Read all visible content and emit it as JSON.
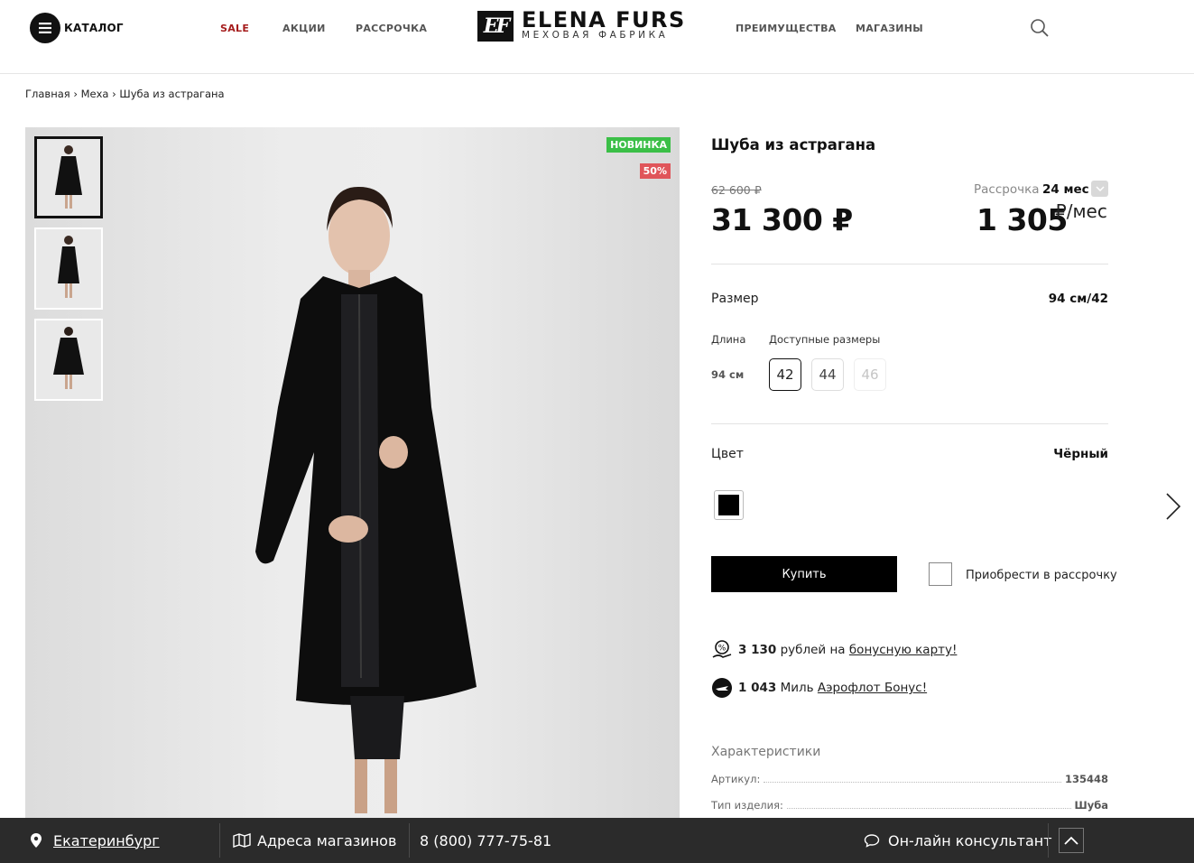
{
  "header": {
    "catalog_label": "КАТАЛОГ",
    "nav_left": [
      "SALE",
      "АКЦИИ",
      "РАССРОЧКА"
    ],
    "nav_right": [
      "ПРЕИМУЩЕСТВА",
      "МАГАЗИНЫ"
    ],
    "logo_mark": "EF",
    "logo_title": "ELENA FURS",
    "logo_subtitle": "МЕХОВАЯ ФАБРИКА",
    "sale_color": "#a51c1c"
  },
  "breadcrumb": [
    "Главная",
    "Меха",
    "Шуба из астрагана"
  ],
  "gallery": {
    "badge_new": "НОВИНКА",
    "badge_discount": "50%",
    "thumbnails_count": 3
  },
  "product": {
    "title": "Шуба из астрагана",
    "old_price": "62 600 ₽",
    "price": "31 300 ₽",
    "installment_label": "Рассрочка",
    "installment_months": "24 мес",
    "installment_amount": "1 305",
    "installment_unit": "₽/мес",
    "size_label": "Размер",
    "size_value": "94 см/42",
    "length_label": "Длина",
    "length_value": "94 см",
    "available_sizes_label": "Доступные размеры",
    "sizes": [
      {
        "label": "42",
        "state": "selected"
      },
      {
        "label": "44",
        "state": "available"
      },
      {
        "label": "46",
        "state": "disabled"
      }
    ],
    "color_label": "Цвет",
    "color_value": "Чёрный",
    "swatch_color": "#000000",
    "buy_label": "Купить",
    "installment_checkbox_label": "Приобрести в рассрочку",
    "bonus_amount": "3 130",
    "bonus_text": "рублей на",
    "bonus_link": "бонусную карту!",
    "miles_amount": "1 043",
    "miles_text": "Миль",
    "miles_link": "Аэрофлот Бонус!",
    "characteristics_title": "Характеристики",
    "characteristics": [
      {
        "name": "Артикул:",
        "value": "135448"
      },
      {
        "name": "Тип изделия:",
        "value": "Шуба"
      }
    ]
  },
  "footer": {
    "city": "Екатеринбург",
    "stores": "Адреса магазинов",
    "phone": "8 (800) 777-75-81",
    "chat": "Он-лайн консультант"
  }
}
